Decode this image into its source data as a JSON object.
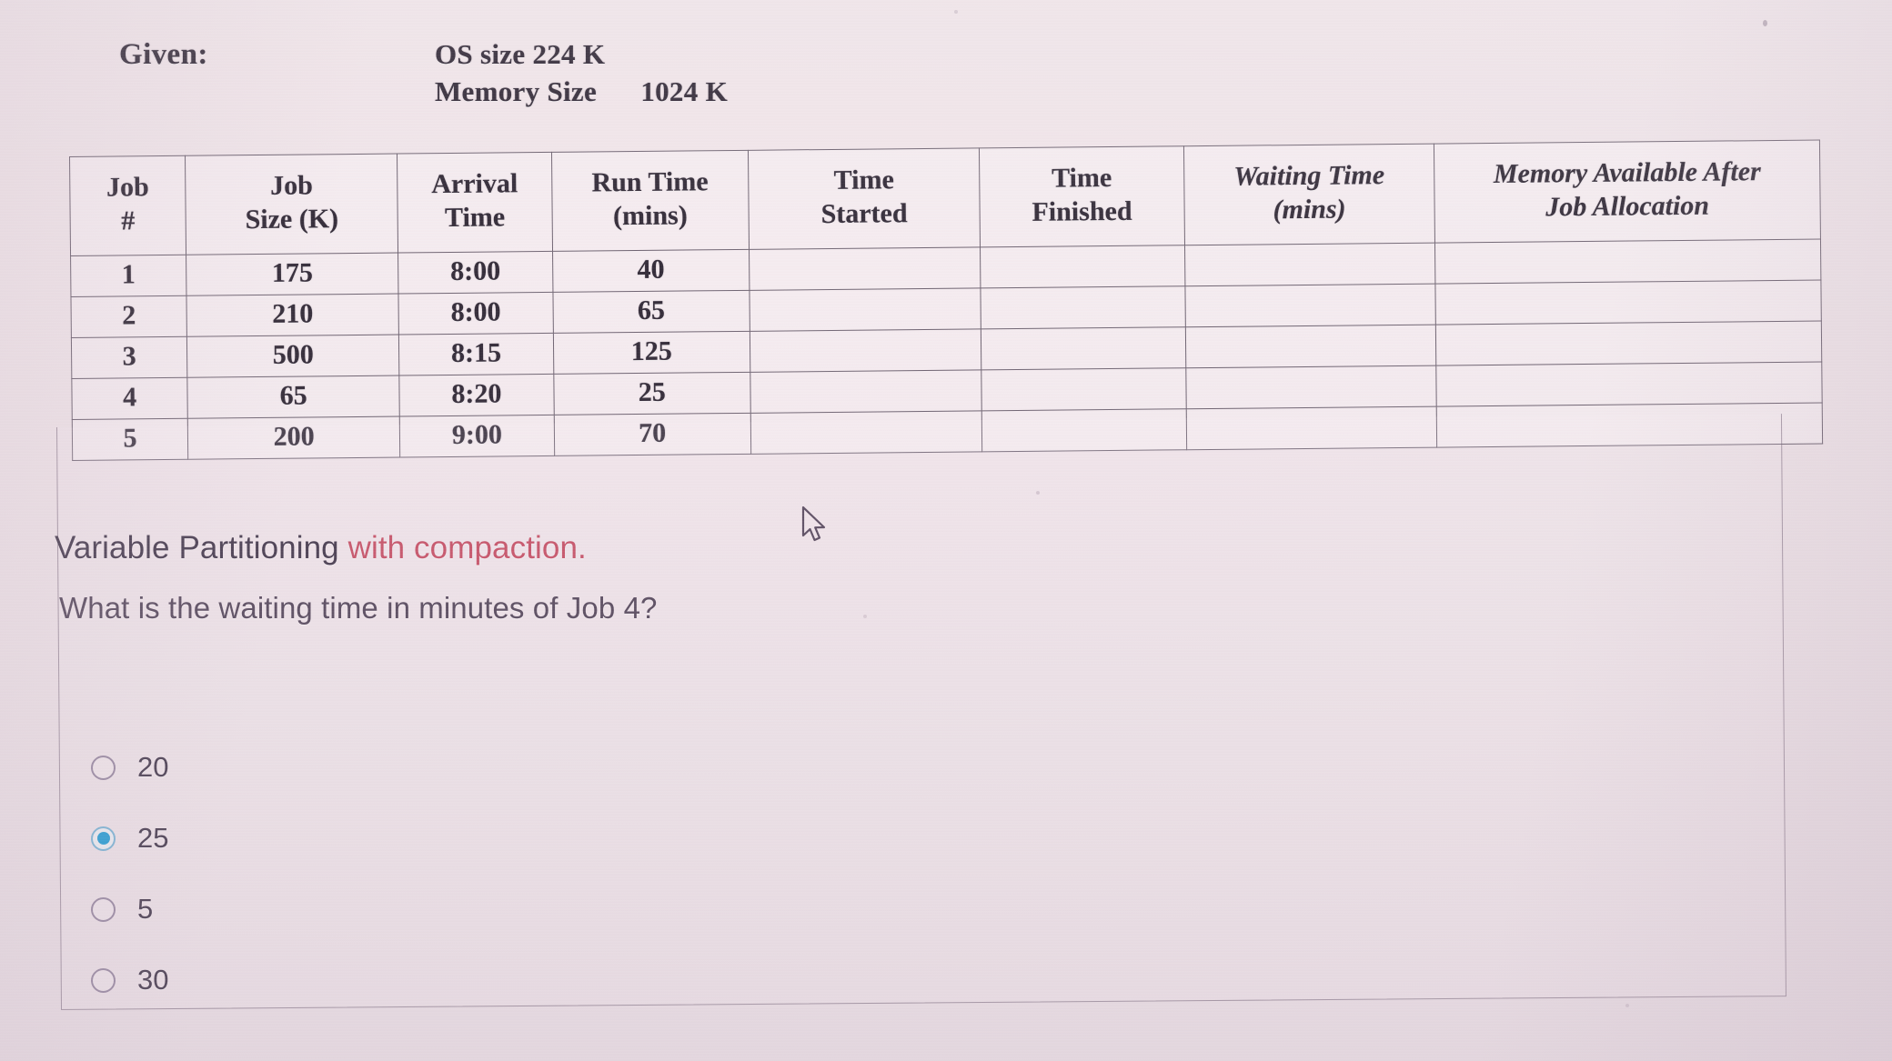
{
  "given": {
    "label": "Given:",
    "os_size": "OS size  224 K",
    "memory_size": "Memory Size      1024 K"
  },
  "table": {
    "headers": [
      {
        "line1": "Job",
        "line2": "#",
        "italic": false
      },
      {
        "line1": "Job",
        "line2": "Size (K)",
        "italic": false
      },
      {
        "line1": "Arrival",
        "line2": "Time",
        "italic": false
      },
      {
        "line1": "Run Time",
        "line2": "(mins)",
        "italic": false
      },
      {
        "line1": "Time",
        "line2": "Started",
        "italic": false
      },
      {
        "line1": "Time",
        "line2": "Finished",
        "italic": false
      },
      {
        "line1": "Waiting Time",
        "line2": "(mins)",
        "italic": true
      },
      {
        "line1": "Memory Available After",
        "line2": "Job Allocation",
        "italic": true
      }
    ],
    "rows": [
      {
        "job": "1",
        "size": "175",
        "arrival": "8:00",
        "run": "40",
        "started": "",
        "finished": "",
        "waiting": "",
        "memory": ""
      },
      {
        "job": "2",
        "size": "210",
        "arrival": "8:00",
        "run": "65",
        "started": "",
        "finished": "",
        "waiting": "",
        "memory": ""
      },
      {
        "job": "3",
        "size": "500",
        "arrival": "8:15",
        "run": "125",
        "started": "",
        "finished": "",
        "waiting": "",
        "memory": ""
      },
      {
        "job": "4",
        "size": "65",
        "arrival": "8:20",
        "run": "25",
        "started": "",
        "finished": "",
        "waiting": "",
        "memory": ""
      },
      {
        "job": "5",
        "size": "200",
        "arrival": "9:00",
        "run": "70",
        "started": "",
        "finished": "",
        "waiting": "",
        "memory": ""
      }
    ]
  },
  "statement": {
    "prefix": "Variable Partitioning ",
    "accent": "with compaction.",
    "accent_color": "#c8566b"
  },
  "question": {
    "text": "What is the waiting time in minutes of Job 4?"
  },
  "options": [
    {
      "label": "20",
      "selected": false
    },
    {
      "label": "25",
      "selected": true
    },
    {
      "label": "5",
      "selected": false
    },
    {
      "label": "30",
      "selected": false
    }
  ],
  "selection_color": "#2a9fd4",
  "cursor": {
    "icon": "arrow-pointer-icon"
  }
}
